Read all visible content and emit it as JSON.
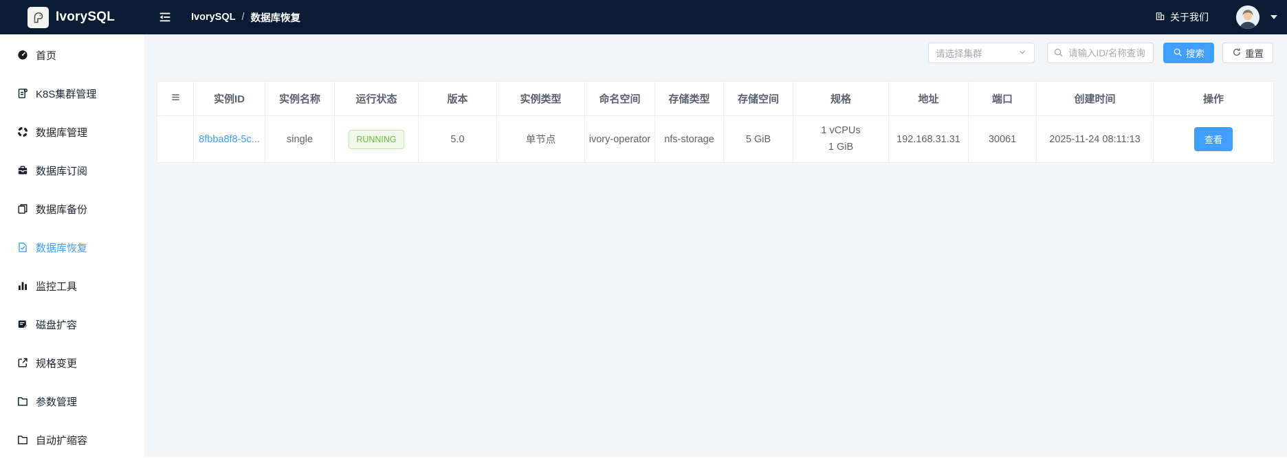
{
  "topbar": {
    "brand": "IvorySQL",
    "breadcrumb": {
      "root": "IvorySQL",
      "separator": "/",
      "current": "数据库恢复"
    },
    "about_label": "关于我们"
  },
  "sidebar": {
    "items": [
      {
        "label": "首页",
        "icon": "dashboard-icon",
        "active": false
      },
      {
        "label": "K8S集群管理",
        "icon": "cluster-file-icon",
        "active": false
      },
      {
        "label": "数据库管理",
        "icon": "database-manage-icon",
        "active": false
      },
      {
        "label": "数据库订阅",
        "icon": "subscription-icon",
        "active": false
      },
      {
        "label": "数据库备份",
        "icon": "backup-copy-icon",
        "active": false
      },
      {
        "label": "数据库恢复",
        "icon": "restore-file-check-icon",
        "active": true
      },
      {
        "label": "监控工具",
        "icon": "monitor-bar-chart-icon",
        "active": false
      },
      {
        "label": "磁盘扩容",
        "icon": "disk-expand-icon",
        "active": false
      },
      {
        "label": "规格变更",
        "icon": "spec-change-export-icon",
        "active": false
      },
      {
        "label": "参数管理",
        "icon": "folder-icon",
        "active": false
      },
      {
        "label": "自动扩缩容",
        "icon": "folder-icon",
        "active": false
      }
    ]
  },
  "filters": {
    "cluster_select_placeholder": "请选择集群",
    "search_placeholder": "请输入ID/名称查询",
    "search_button": "搜索",
    "reset_button": "重置"
  },
  "table": {
    "headers": [
      "实例ID",
      "实例名称",
      "运行状态",
      "版本",
      "实例类型",
      "命名空间",
      "存储类型",
      "存储空间",
      "规格",
      "地址",
      "端口",
      "创建时间",
      "操作"
    ],
    "row": {
      "instance_id": "8fbba8f8-5c...",
      "instance_name": "single",
      "status": "RUNNING",
      "version": "5.0",
      "instance_type": "单节点",
      "namespace": "ivory-operator",
      "storage_type": "nfs-storage",
      "storage_size": "5 GiB",
      "spec_line1": "1 vCPUs",
      "spec_line2": "1 GiB",
      "address": "192.168.31.31",
      "port": "30061",
      "created_at": "2025-11-24 08:11:13",
      "action_label": "查看"
    }
  },
  "colors": {
    "accent": "#409eff",
    "topbar_bg": "#0a1c33",
    "success_text": "#67c23a",
    "success_bg": "#f0f9eb",
    "content_bg": "#f4f5f7"
  }
}
